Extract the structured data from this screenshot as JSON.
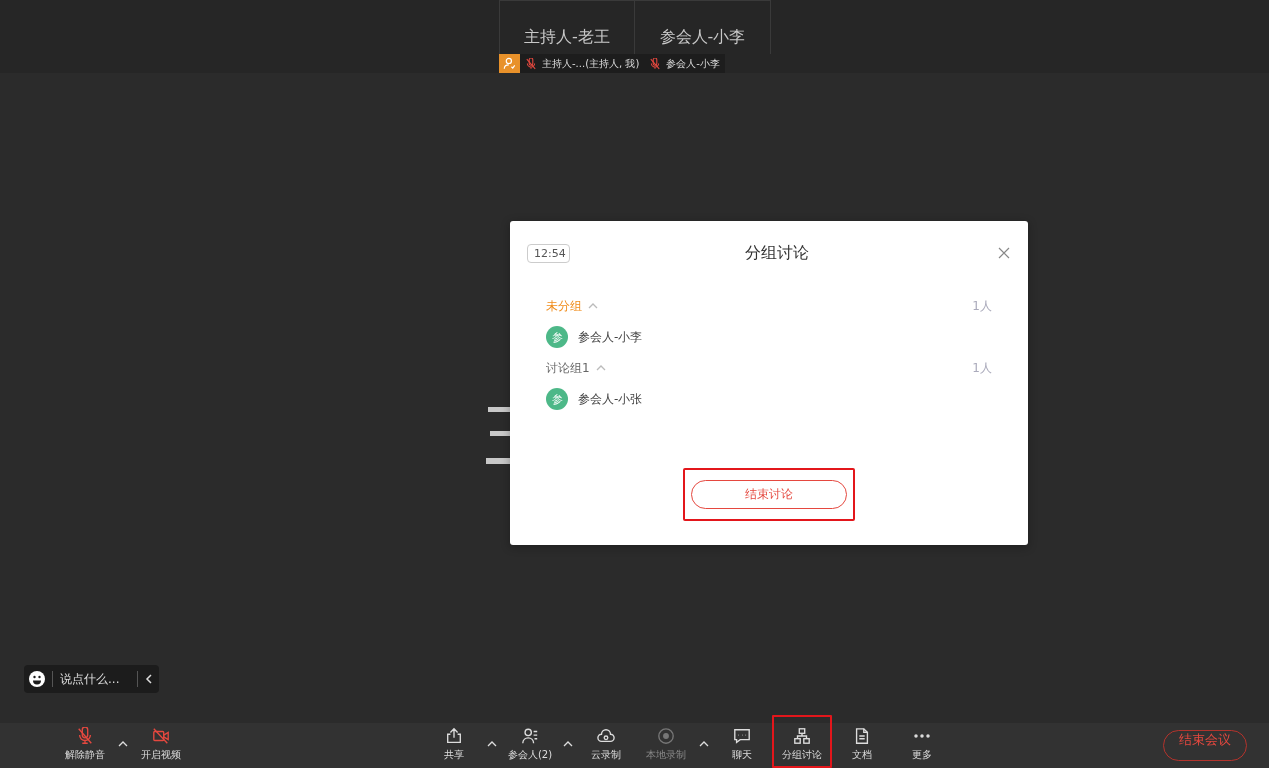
{
  "video_tiles": [
    {
      "name": "主持人-老王"
    },
    {
      "name": "参会人-小李"
    }
  ],
  "name_strip": {
    "host_badge": true,
    "labels": [
      {
        "text": "主持人-...(主持人, 我)",
        "muted": true
      },
      {
        "text": "参会人-小李",
        "muted": true
      }
    ]
  },
  "dialog": {
    "timer": "12:54",
    "title": "分组讨论",
    "groups": [
      {
        "name": "未分组",
        "count": "1人",
        "selected": true,
        "expanded": true,
        "members": [
          {
            "avatar": "参",
            "name": "参会人-小李"
          }
        ]
      },
      {
        "name": "讨论组1",
        "count": "1人",
        "selected": false,
        "expanded": true,
        "members": [
          {
            "avatar": "参",
            "name": "参会人-小张"
          }
        ]
      }
    ],
    "end_button": {
      "label": "结束讨论",
      "highlighted": true
    }
  },
  "chat_input": {
    "placeholder": "说点什么..."
  },
  "toolbar": {
    "left": [
      {
        "kind": "mic",
        "label": "解除静音",
        "off": true,
        "disabled": false,
        "has_menu": true,
        "highlighted": false
      },
      {
        "kind": "video",
        "label": "开启视频",
        "off": true,
        "disabled": false,
        "has_menu": false,
        "highlighted": false
      }
    ],
    "center": [
      {
        "kind": "share",
        "label": "共享",
        "off": false,
        "disabled": false,
        "has_menu": true,
        "highlighted": false
      },
      {
        "kind": "participants",
        "label": "参会人(2)",
        "off": false,
        "disabled": false,
        "has_menu": true,
        "highlighted": false
      },
      {
        "kind": "cloud",
        "label": "云录制",
        "off": false,
        "disabled": false,
        "has_menu": false,
        "highlighted": false
      },
      {
        "kind": "record",
        "label": "本地录制",
        "off": false,
        "disabled": true,
        "has_menu": true,
        "highlighted": false
      },
      {
        "kind": "chat",
        "label": "聊天",
        "off": false,
        "disabled": false,
        "has_menu": false,
        "highlighted": false
      },
      {
        "kind": "breakout",
        "label": "分组讨论",
        "off": false,
        "disabled": false,
        "has_menu": false,
        "highlighted": true
      },
      {
        "kind": "doc",
        "label": "文档",
        "off": false,
        "disabled": false,
        "has_menu": false,
        "highlighted": false
      },
      {
        "kind": "more",
        "label": "更多",
        "off": false,
        "disabled": false,
        "has_menu": false,
        "highlighted": false
      }
    ],
    "end_button": {
      "label": "结束会议"
    }
  }
}
